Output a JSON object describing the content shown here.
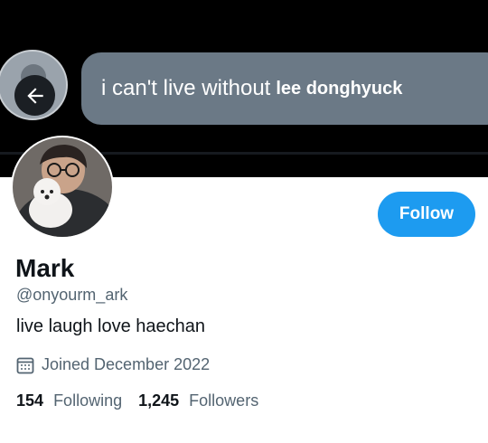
{
  "banner": {
    "message_text": "i can't live without",
    "message_name": "lee donghyuck",
    "bubble_color": "#6b7986",
    "icons": [
      "back-arrow-icon"
    ]
  },
  "profile": {
    "display_name": "Mark",
    "handle": "@onyourm_ark",
    "bio": "live laugh love haechan",
    "joined": "Joined December 2022",
    "following_count": "154",
    "following_label": "Following",
    "followers_count": "1,245",
    "followers_label": "Followers",
    "icons": [
      "calendar-icon"
    ]
  },
  "actions": {
    "follow_label": "Follow",
    "accent_color": "#1d9bf0"
  }
}
